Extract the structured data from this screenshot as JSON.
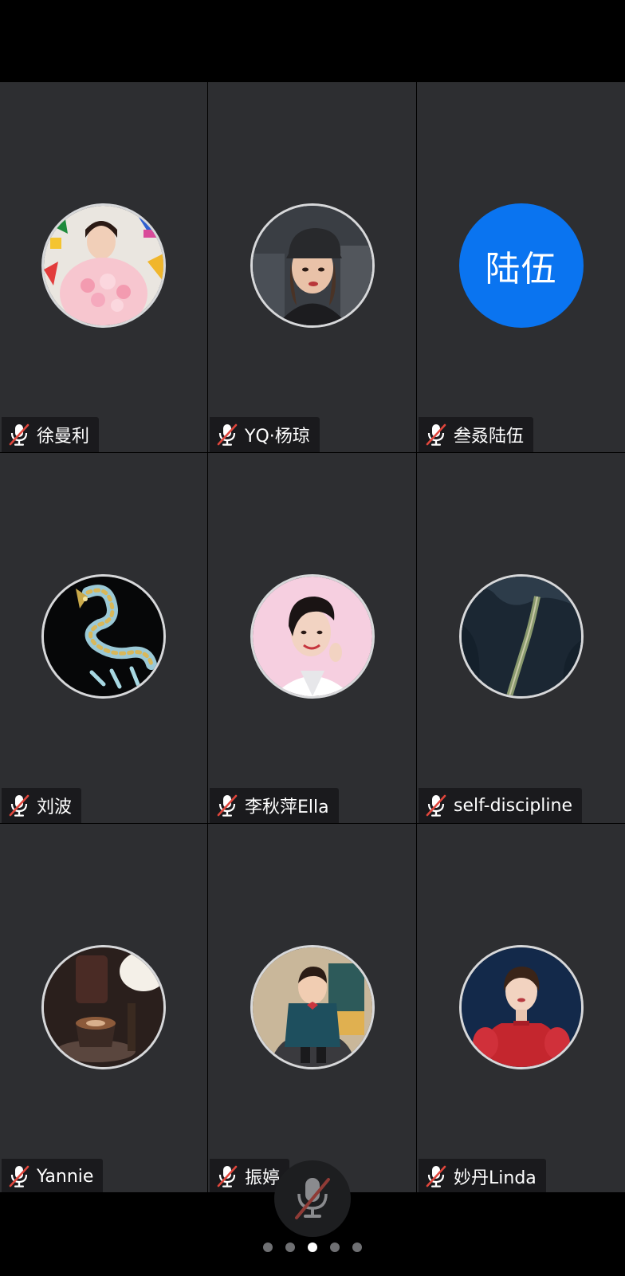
{
  "participants": [
    {
      "name": "徐曼利",
      "avatar": "photo-flowers",
      "muted": true
    },
    {
      "name": "YQ·杨琼",
      "avatar": "photo-cap",
      "muted": true
    },
    {
      "name": "叁叒陆伍",
      "avatar": "text",
      "avatar_text": "陆伍",
      "avatar_color": "#0a74f0",
      "muted": true
    },
    {
      "name": "刘波",
      "avatar": "photo-dragon",
      "muted": true
    },
    {
      "name": "李秋萍Ella",
      "avatar": "photo-portrait-pink",
      "muted": true
    },
    {
      "name": "self-discipline",
      "avatar": "photo-aerial-coast",
      "muted": true
    },
    {
      "name": "Yannie",
      "avatar": "photo-coffee",
      "muted": true
    },
    {
      "name": "振婷",
      "avatar": "photo-child",
      "muted": true
    },
    {
      "name": "妙丹Linda",
      "avatar": "photo-red-dress",
      "muted": true
    }
  ],
  "controls": {
    "mic_button": {
      "icon": "mic-off-icon",
      "state": "muted"
    }
  },
  "pager": {
    "total": 5,
    "active_index": 2
  },
  "colors": {
    "tile_background": "#2d2e31",
    "screen_background": "#000000",
    "mute_slash": "#e0463c",
    "text_avatar_blue": "#0a74f0"
  }
}
